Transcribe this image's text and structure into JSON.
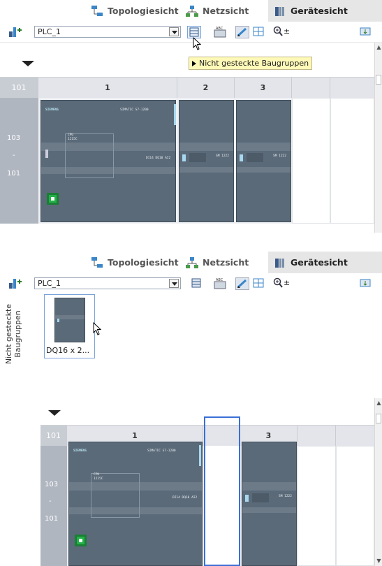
{
  "tabs": {
    "topology": "Topologiesicht",
    "network": "Netzsicht",
    "device": "Gerätesicht"
  },
  "toolbar": {
    "device_select": "PLC_1",
    "zoom_symbol": "±"
  },
  "tooltip": "Nicht gesteckte Baugruppen",
  "rack": {
    "header_row": "101",
    "slots": [
      "1",
      "2",
      "3"
    ],
    "row_labels": [
      "103",
      "-",
      "101"
    ]
  },
  "modules": {
    "cpu_brand": "SIEMENS",
    "cpu_model": "SIMATIC S7-1200",
    "cpu_sub_1": "CPU",
    "cpu_sub_2": "1215C",
    "cpu_io": "DI14 DQ10 AI2",
    "sm_label_2": "SM 1222",
    "sm_label_3": "SM 1222"
  },
  "unplugged": {
    "title": "Nicht gesteckte Baugruppen",
    "item_label": "DQ16 x 2..."
  },
  "colors": {
    "module": "#5b6a78",
    "highlight": "#3a6fd6",
    "tooltip_bg": "#fff9b8",
    "status_green": "#25b14a"
  }
}
